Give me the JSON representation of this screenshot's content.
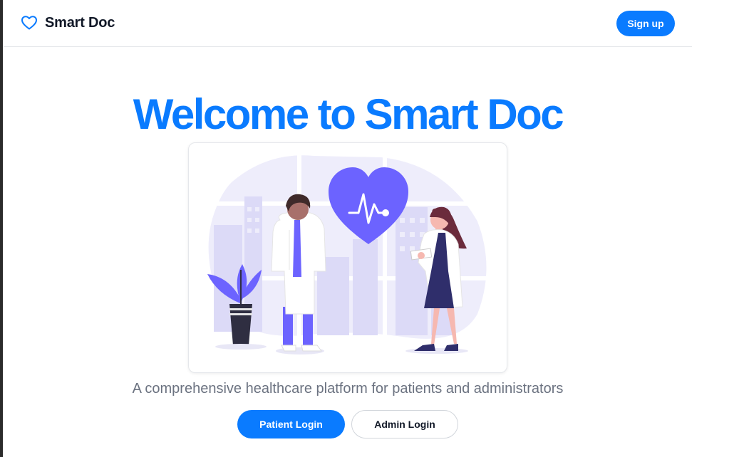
{
  "header": {
    "brand_name": "Smart Doc",
    "brand_icon": "heart-icon",
    "signup_label": "Sign up"
  },
  "hero": {
    "title": "Welcome to Smart Doc",
    "illustration": "doctors-illustration",
    "subtitle": "A comprehensive healthcare platform for patients and administrators"
  },
  "actions": {
    "patient_login_label": "Patient Login",
    "admin_login_label": "Admin Login"
  },
  "colors": {
    "accent": "#0a7bff",
    "illustration_primary": "#6c63ff",
    "illustration_bg": "#eeedfb",
    "text_muted": "#6b7280"
  }
}
